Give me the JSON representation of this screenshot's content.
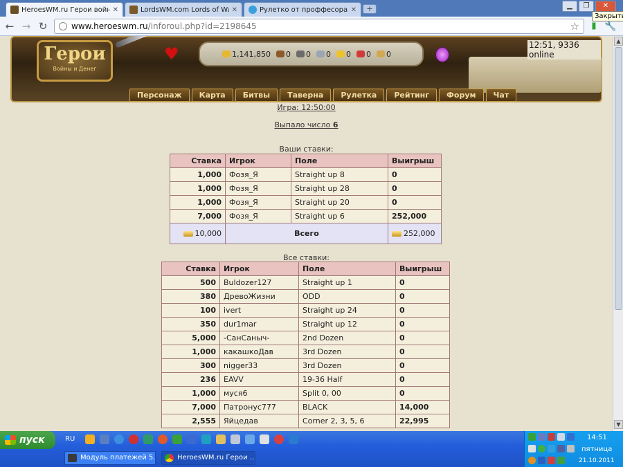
{
  "browser": {
    "tabs": [
      {
        "title": "HeroesWM.ru Герои войны и",
        "active": true,
        "favicon_color": "#6b4e22"
      },
      {
        "title": "LordsWM.com Lords of War an",
        "active": false,
        "favicon_color": "#7a5a2a"
      },
      {
        "title": "Рулетко от проффесора - де",
        "active": false,
        "favicon_color": "#39a0dc"
      }
    ],
    "tooltip": "Закрыть",
    "url_host": "www.heroeswm.ru",
    "url_path": "/inforoul.php?id=2198645"
  },
  "header": {
    "logo_title": "Герои",
    "logo_subtitle": "Войны и Денег",
    "resources": [
      {
        "icon": "gold-icon",
        "value": "1,141,850",
        "color": "#e5b830"
      },
      {
        "icon": "wood-icon",
        "value": "0",
        "color": "#8b5a2b"
      },
      {
        "icon": "ore-icon",
        "value": "0",
        "color": "#6b6b6b"
      },
      {
        "icon": "mercury-icon",
        "value": "0",
        "color": "#9aa6b4"
      },
      {
        "icon": "sulfur-icon",
        "value": "0",
        "color": "#f0c22a"
      },
      {
        "icon": "crystal-icon",
        "value": "0",
        "color": "#d23a3a"
      },
      {
        "icon": "gems-icon",
        "value": "0",
        "color": "#d2a850"
      }
    ],
    "clock": "12:51, 9336 online",
    "menu": [
      "Персонаж",
      "Карта",
      "Битвы",
      "Таверна",
      "Рулетка",
      "Рейтинг",
      "Форум",
      "Чат"
    ]
  },
  "game_link": "Игра: 12:50:00",
  "result_label": "Выпало число",
  "result_number": "6",
  "my_bets": {
    "caption": "Ваши ставки:",
    "columns": [
      "Ставка",
      "Игрок",
      "Поле",
      "Выигрыш"
    ],
    "rows": [
      {
        "bet": "1,000",
        "player": "Фозя_Я",
        "field": "Straight up 8",
        "win": "0"
      },
      {
        "bet": "1,000",
        "player": "Фозя_Я",
        "field": "Straight up 28",
        "win": "0"
      },
      {
        "bet": "1,000",
        "player": "Фозя_Я",
        "field": "Straight up 20",
        "win": "0"
      },
      {
        "bet": "7,000",
        "player": "Фозя_Я",
        "field": "Straight up 6",
        "win": "252,000"
      }
    ],
    "total_bet": "10,000",
    "total_label": "Всего",
    "total_win": "252,000"
  },
  "all_bets": {
    "caption": "Все ставки:",
    "columns": [
      "Ставка",
      "Игрок",
      "Поле",
      "Выигрыш"
    ],
    "rows": [
      {
        "bet": "500",
        "player": "Buldozer127",
        "field": "Straight up 1",
        "win": "0"
      },
      {
        "bet": "380",
        "player": "ДревоЖизни",
        "field": "ODD",
        "win": "0"
      },
      {
        "bet": "100",
        "player": "ivert",
        "field": "Straight up 24",
        "win": "0"
      },
      {
        "bet": "350",
        "player": "dur1mar",
        "field": "Straight up 12",
        "win": "0"
      },
      {
        "bet": "5,000",
        "player": "-СанСаныч-",
        "field": "2nd Dozen",
        "win": "0"
      },
      {
        "bet": "1,000",
        "player": "какашкоДав",
        "field": "3rd Dozen",
        "win": "0"
      },
      {
        "bet": "300",
        "player": "nigger33",
        "field": "3rd Dozen",
        "win": "0"
      },
      {
        "bet": "236",
        "player": "EAVV",
        "field": "19-36 Half",
        "win": "0"
      },
      {
        "bet": "1,000",
        "player": "муся6",
        "field": "Split 0, 00",
        "win": "0"
      },
      {
        "bet": "7,000",
        "player": "Патронус777",
        "field": "BLACK",
        "win": "14,000"
      },
      {
        "bet": "2,555",
        "player": "Яйцедав",
        "field": "Corner 2, 3, 5, 6",
        "win": "22,995"
      }
    ]
  },
  "taskbar": {
    "start_label": "пуск",
    "language": "RU",
    "buttons": [
      "Модуль платежей 5...",
      "HeroesWM.ru Герои ..."
    ],
    "time": "14:51",
    "day": "пятница",
    "date": "21.10.2011"
  }
}
